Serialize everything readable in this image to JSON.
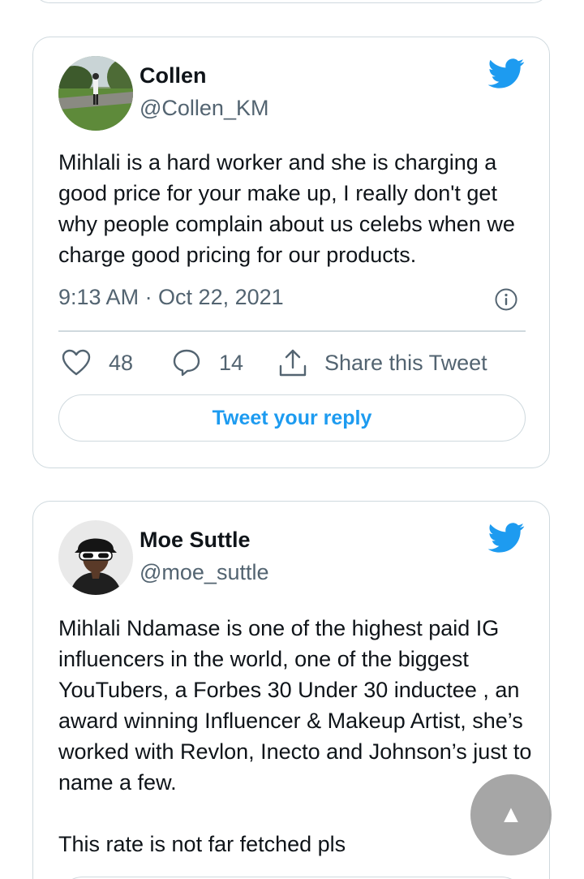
{
  "tweets": [
    {
      "name": "Collen",
      "handle": "@Collen_KM",
      "text": "Mihlali is a hard worker and she is charging a good price for your make up, I really don't get why people complain about us celebs when we charge good pricing for our products.",
      "timestamp": "9:13 AM · Oct 22, 2021",
      "likes": "48",
      "replies": "14",
      "share_label": "Share this Tweet",
      "reply_button_label": "Tweet your reply",
      "avatar_icon": "avatar-photo-icon"
    },
    {
      "name": "Moe Suttle",
      "handle": "@moe_suttle",
      "text": "Mihlali Ndamase is one of the highest paid IG influencers in the world, one of the biggest YouTubers, a Forbes 30 Under 30 inductee , an award winning Influencer & Makeup Artist, she’s worked with Revlon, Inecto and Johnson’s just to name a few.\n\nThis rate is not far fetched pls",
      "avatar_icon": "avatar-photo-icon"
    }
  ],
  "scroll_top_label": "▲",
  "colors": {
    "twitter_blue": "#1d9bf0",
    "border": "#cfd9de",
    "secondary_text": "#536471",
    "primary_text": "#0f1419"
  },
  "icons": [
    "twitter-bird-icon",
    "info-icon",
    "heart-icon",
    "reply-bubble-icon",
    "share-icon",
    "scroll-top-icon"
  ]
}
